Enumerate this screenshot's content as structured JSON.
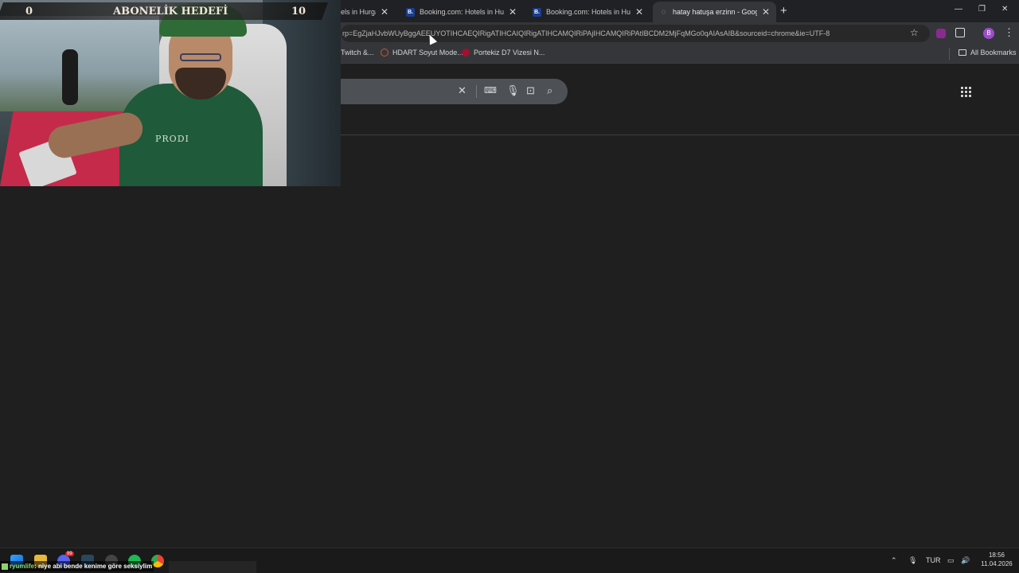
{
  "stream_overlay": {
    "goal_current": "0",
    "goal_title": "ABONELİK HEDEFİ",
    "goal_target": "10",
    "shirt_text": "PRODI",
    "chat": {
      "user": "ryumlife",
      "message": ": niye abi bende kenime göre seksiylim"
    }
  },
  "browser": {
    "tabs": [
      {
        "title": "els in Hurgad",
        "favicon": "booking-icon",
        "active": false
      },
      {
        "title": "Booking.com: Hotels in Hurgad",
        "favicon": "booking-icon",
        "active": false
      },
      {
        "title": "Booking.com: Hotels in Hurgad",
        "favicon": "booking-icon",
        "active": false
      },
      {
        "title": "hatay hatuşa erzinn - Google'd",
        "favicon": "google-icon",
        "active": true
      }
    ],
    "favicon_letter": "B.",
    "new_tab_glyph": "+",
    "url": "rp=EgZjaHJvbWUyBggAEEUYOTIHCAEQIRigATIHCAIQIRigATIHCAMQIRiPAjIHCAMQIRiPAtIBCDM2MjFqMGo0qAIAsAIB&sourceid=chrome&ie=UTF-8",
    "profile_initial": "B",
    "bookmarks": [
      {
        "label": "Twitch &...",
        "color": ""
      },
      {
        "label": "HDART Soyut Mode...",
        "color": "#d9532b"
      },
      {
        "label": "Portekiz D7 Vizesi N...",
        "color": "#a01030"
      }
    ],
    "all_bookmarks_label": "All Bookmarks"
  },
  "taskbar": {
    "language": "TUR",
    "time": "18:56",
    "date": "11.04.2026",
    "discord_badge": "99"
  },
  "colors": {
    "page_bg": "#1f1f1f",
    "toolbar_bg": "#35363a",
    "tabstrip_bg": "#202124",
    "searchbox_bg": "#4d5156"
  }
}
